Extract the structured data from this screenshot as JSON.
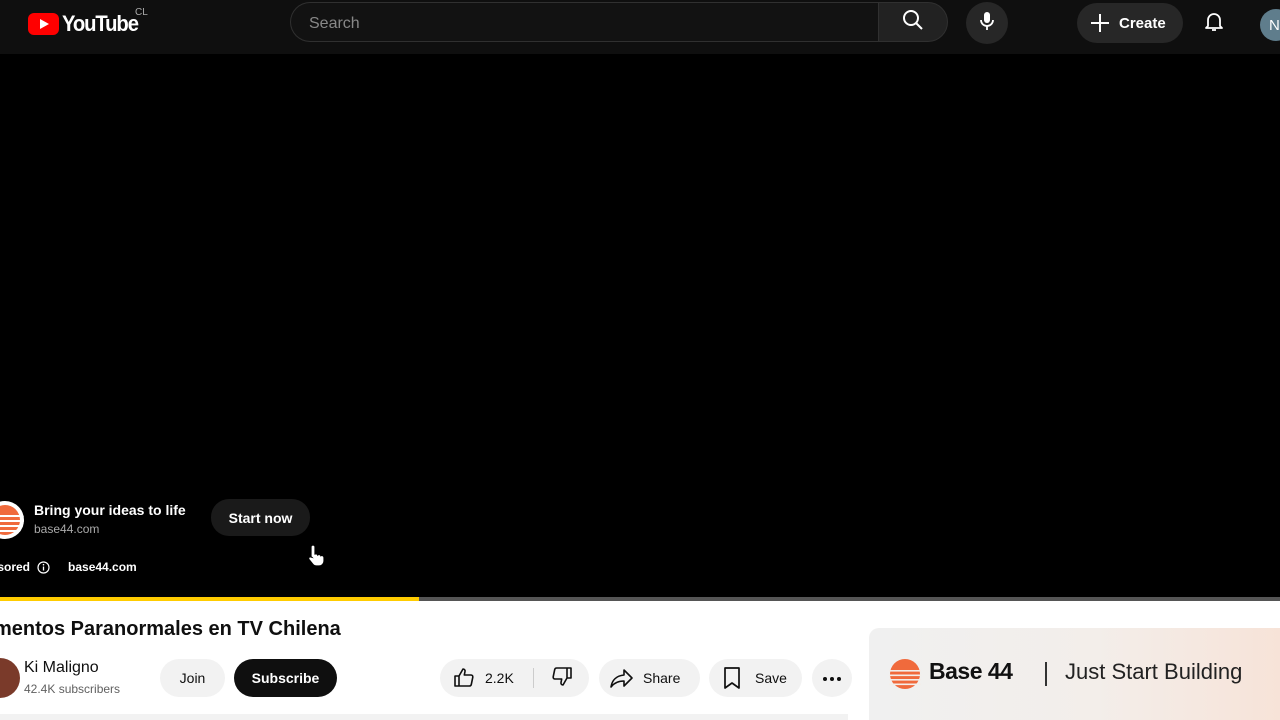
{
  "header": {
    "logo_text": "YouTube",
    "country_code": "CL",
    "search_placeholder": "Search",
    "create_label": "Create",
    "avatar_initial": "N"
  },
  "player": {
    "progress_fraction": 0.327,
    "progress_color": "#ffcc00",
    "ad": {
      "headline": "Bring your ideas to life",
      "domain": "base44.com",
      "cta_label": "Start now",
      "sponsored_label": "nsored",
      "sponsored_domain": "base44.com"
    }
  },
  "video": {
    "title": "mentos Paranormales en TV Chilena",
    "channel_name": "Ki Maligno",
    "channel_subscribers": "42.4K subscribers",
    "join_label": "Join",
    "subscribe_label": "Subscribe",
    "like_count": "2.2K",
    "share_label": "Share",
    "save_label": "Save"
  },
  "companion_ad": {
    "brand": "Base 44",
    "tagline": "Just Start Building"
  },
  "icons": [
    "search-icon",
    "microphone-icon",
    "plus-icon",
    "bell-icon",
    "info-icon",
    "cursor-icon",
    "thumbs-up-icon",
    "thumbs-down-icon",
    "share-icon",
    "bookmark-icon",
    "more-icon"
  ],
  "colors": {
    "brand_red": "#ff0000",
    "topbar_bg": "#0f0f0f",
    "accent_orange": "#f06a3c"
  }
}
